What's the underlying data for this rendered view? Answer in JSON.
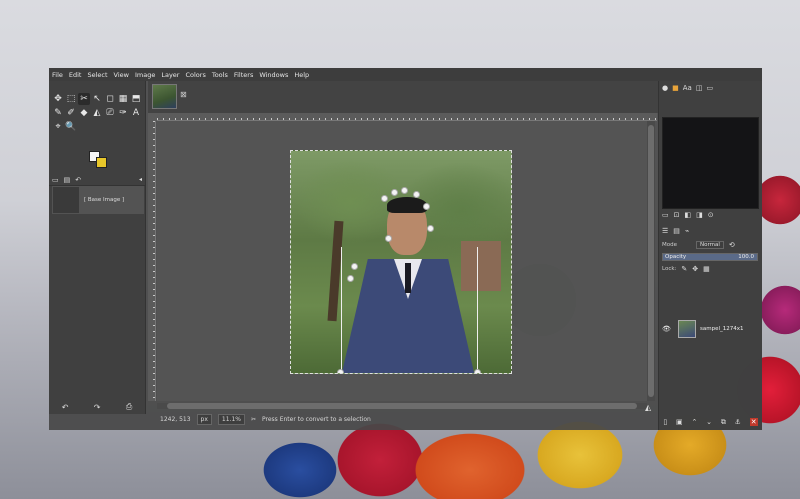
{
  "menu": [
    "File",
    "Edit",
    "Select",
    "View",
    "Image",
    "Layer",
    "Colors",
    "Tools",
    "Filters",
    "Windows",
    "Help"
  ],
  "toolbox": {
    "tools_row1": [
      "✥",
      "⬚",
      "✂",
      "↖",
      "◻",
      "▦",
      "⬒"
    ],
    "tools_row2": [
      "✎",
      "✐",
      "◆",
      "◭",
      "⎚",
      "✑",
      "A"
    ],
    "tools_row3": [
      "⌖",
      "🔍"
    ],
    "images_tab_label": "[ Base Image ]",
    "bottom_icons": [
      "↶",
      "↷",
      "⎙"
    ]
  },
  "canvas": {
    "close_glyph": "⊠"
  },
  "status": {
    "coords": "1242, 513",
    "unit": "px",
    "zoom": "11.1%",
    "message": "Press Enter to convert to a selection"
  },
  "layers": {
    "mode_label": "Mode",
    "mode_value": "Normal",
    "opacity_label": "Opacity",
    "opacity_value": "100.0",
    "lock_label": "Lock:",
    "layer_name": "sampel_1274x1"
  },
  "colors": {
    "fg": "#f4f4f4",
    "bg": "#e8c72a"
  }
}
